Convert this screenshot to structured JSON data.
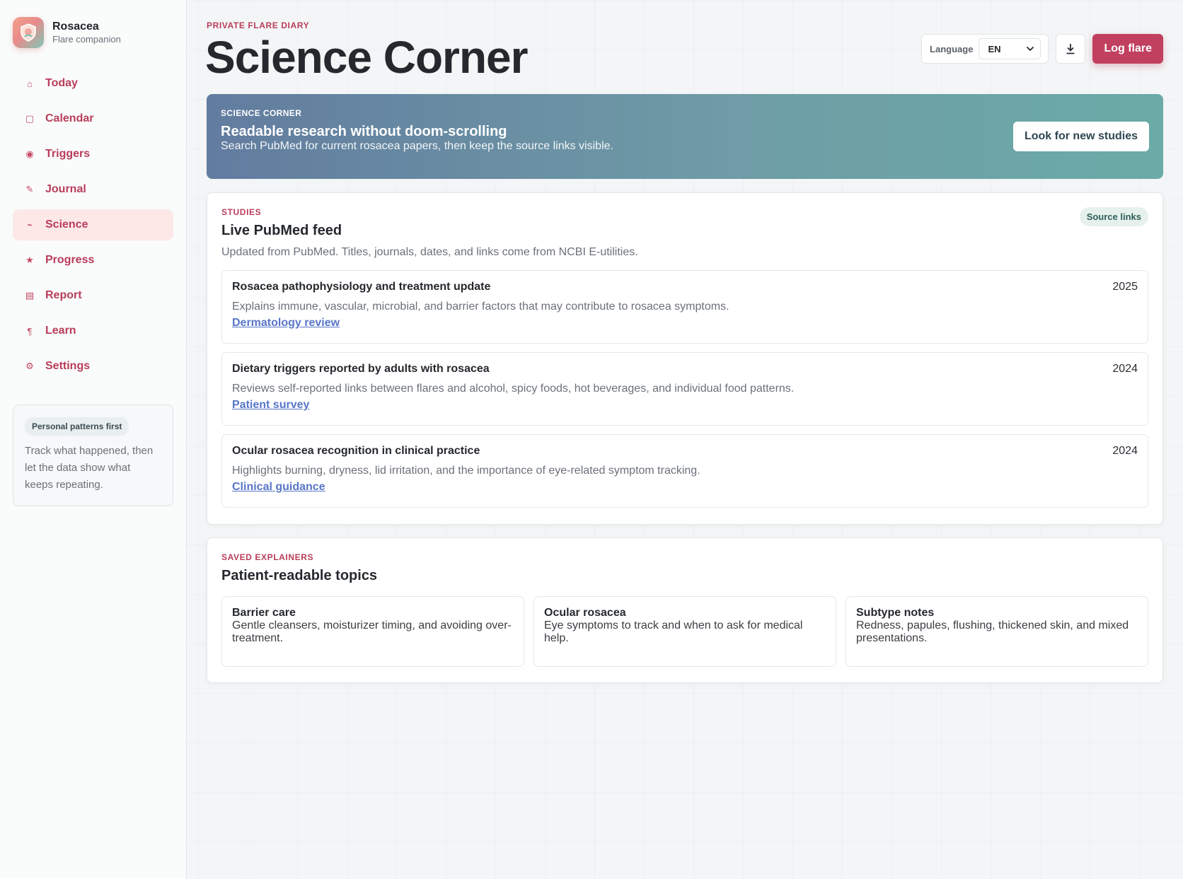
{
  "app": {
    "name": "Rosacea",
    "subtitle": "Flare companion"
  },
  "sidebar": {
    "items": [
      {
        "label": "Today",
        "icon": "⌂"
      },
      {
        "label": "Calendar",
        "icon": "▢"
      },
      {
        "label": "Triggers",
        "icon": "◉"
      },
      {
        "label": "Journal",
        "icon": "✎"
      },
      {
        "label": "Science",
        "icon": "⌁"
      },
      {
        "label": "Progress",
        "icon": "★"
      },
      {
        "label": "Report",
        "icon": "▤"
      },
      {
        "label": "Learn",
        "icon": "¶"
      },
      {
        "label": "Settings",
        "icon": "⚙"
      }
    ],
    "active": "Science",
    "card": {
      "badge": "Personal patterns first",
      "text": "Track what happened, then let the data show what keeps repeating."
    }
  },
  "header": {
    "kicker": "PRIVATE FLARE DIARY",
    "title": "Science Corner",
    "language_label": "Language",
    "language_value": "EN",
    "log_button": "Log flare",
    "download_icon": "download-icon"
  },
  "hero": {
    "kicker": "SCIENCE CORNER",
    "title": "Readable research without doom-scrolling",
    "subtitle": "Search PubMed for current rosacea papers, then keep the source links visible.",
    "button": "Look for new studies"
  },
  "studies": {
    "kicker": "STUDIES",
    "title": "Live PubMed feed",
    "description": "Updated from PubMed. Titles, journals, dates, and links come from NCBI E-utilities.",
    "badge": "Source links",
    "items": [
      {
        "title": "Rosacea pathophysiology and treatment update",
        "year": "2025",
        "description": "Explains immune, vascular, microbial, and barrier factors that may contribute to rosacea symptoms.",
        "link": "Dermatology review"
      },
      {
        "title": "Dietary triggers reported by adults with rosacea",
        "year": "2024",
        "description": "Reviews self-reported links between flares and alcohol, spicy foods, hot beverages, and individual food patterns.",
        "link": "Patient survey"
      },
      {
        "title": "Ocular rosacea recognition in clinical practice",
        "year": "2024",
        "description": "Highlights burning, dryness, lid irritation, and the importance of eye-related symptom tracking.",
        "link": "Clinical guidance"
      }
    ]
  },
  "explainers": {
    "kicker": "SAVED EXPLAINERS",
    "title": "Patient-readable topics",
    "items": [
      {
        "title": "Barrier care",
        "text": "Gentle cleansers, moisturizer timing, and avoiding over-treatment."
      },
      {
        "title": "Ocular rosacea",
        "text": "Eye symptoms to track and when to ask for medical help."
      },
      {
        "title": "Subtype notes",
        "text": "Redness, papules, flushing, thickened skin, and mixed presentations."
      }
    ]
  },
  "colors": {
    "accent": "#c1405f",
    "nav_text": "#b93d5a",
    "link": "#5876c8",
    "hero_start": "#627c9f",
    "hero_end": "#6aaba7"
  }
}
